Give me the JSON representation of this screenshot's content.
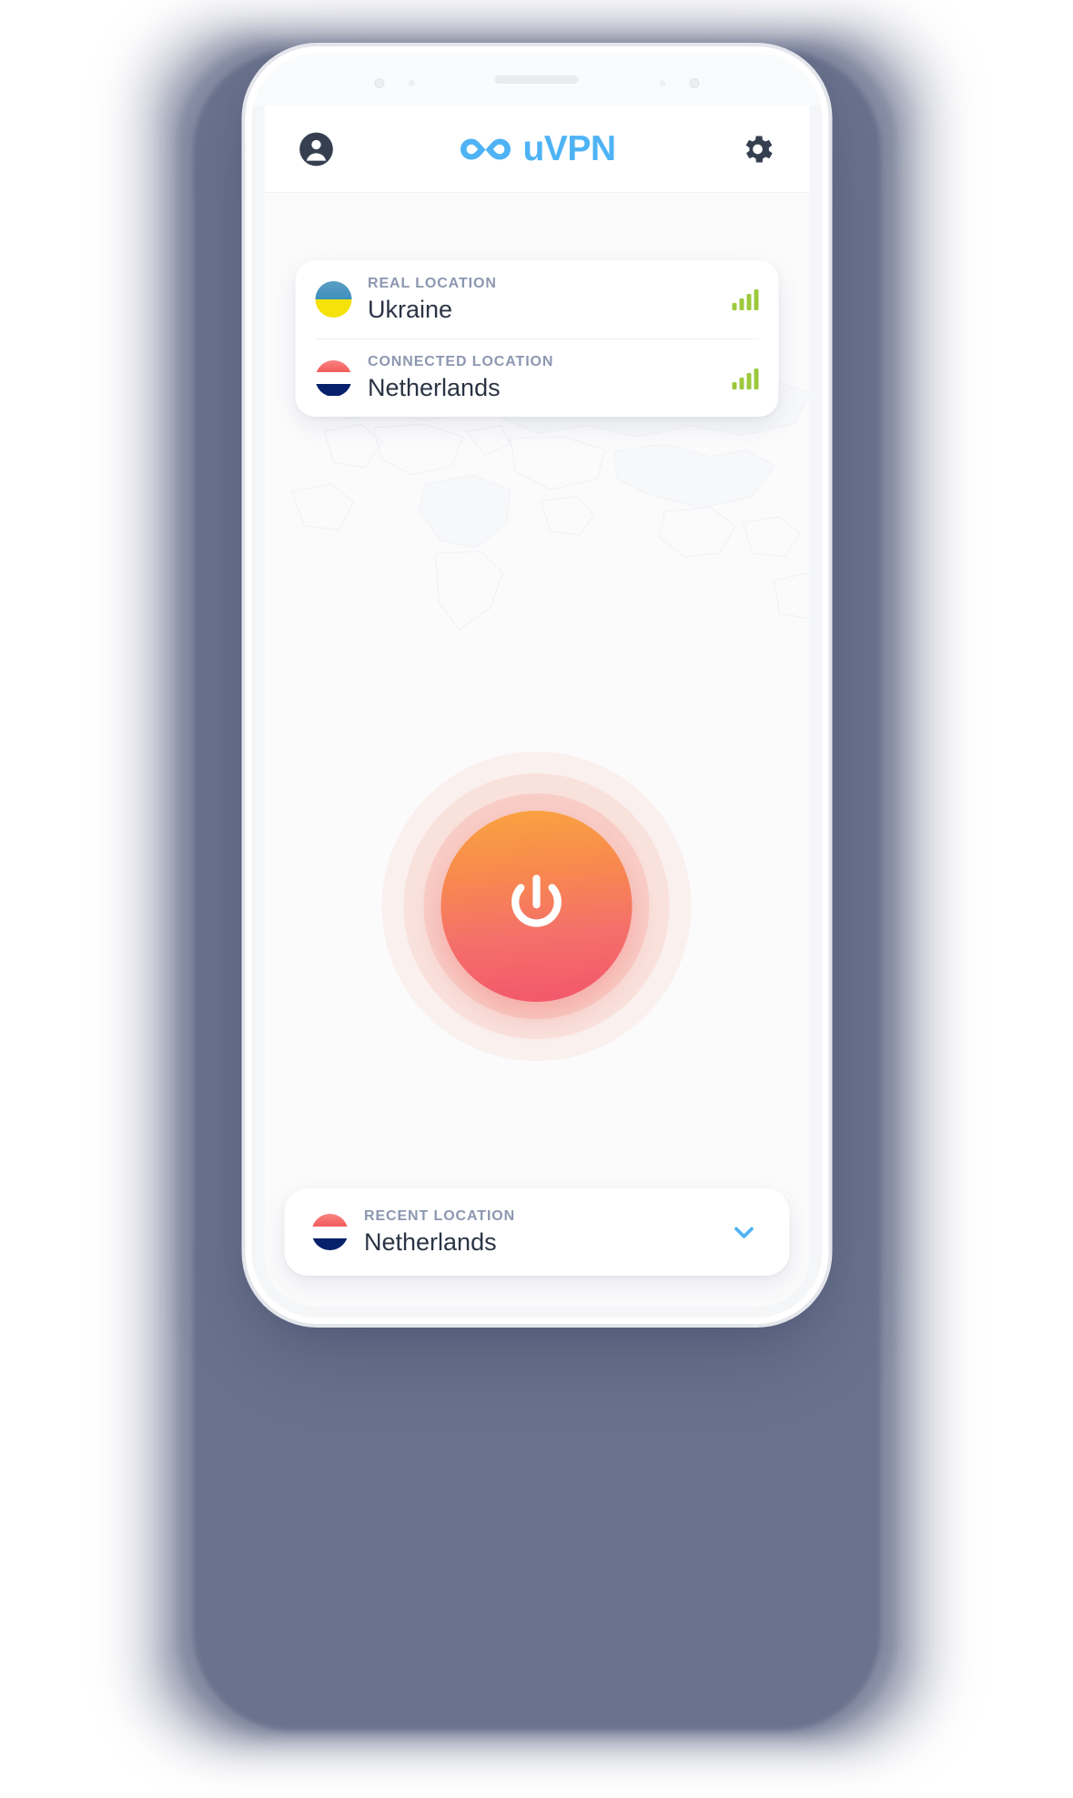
{
  "app": {
    "brand_name": "uVPN",
    "logo_icon": "infinity-logo-icon",
    "accent_blue": "#4EB3F5",
    "accent_green": "#9CC93C",
    "power_gradient_from": "#F9A43F",
    "power_gradient_to": "#F3556B",
    "text_dark": "#2B3445",
    "label_gray": "#8C97B0"
  },
  "header": {
    "profile_icon": "account-circle-icon",
    "settings_icon": "gear-icon"
  },
  "location_card": {
    "rows": [
      {
        "label": "REAL LOCATION",
        "value": "Ukraine",
        "flag_icon": "flag-ukraine-icon",
        "signal_icon": "signal-bars-icon",
        "signal_bars": 4
      },
      {
        "label": "CONNECTED LOCATION",
        "value": "Netherlands",
        "flag_icon": "flag-netherlands-icon",
        "signal_icon": "signal-bars-icon",
        "signal_bars": 4
      }
    ]
  },
  "power": {
    "icon": "power-icon",
    "state": "connected"
  },
  "recent": {
    "label": "RECENT LOCATION",
    "value": "Netherlands",
    "flag_icon": "flag-netherlands-icon",
    "chevron_icon": "chevron-down-icon"
  }
}
